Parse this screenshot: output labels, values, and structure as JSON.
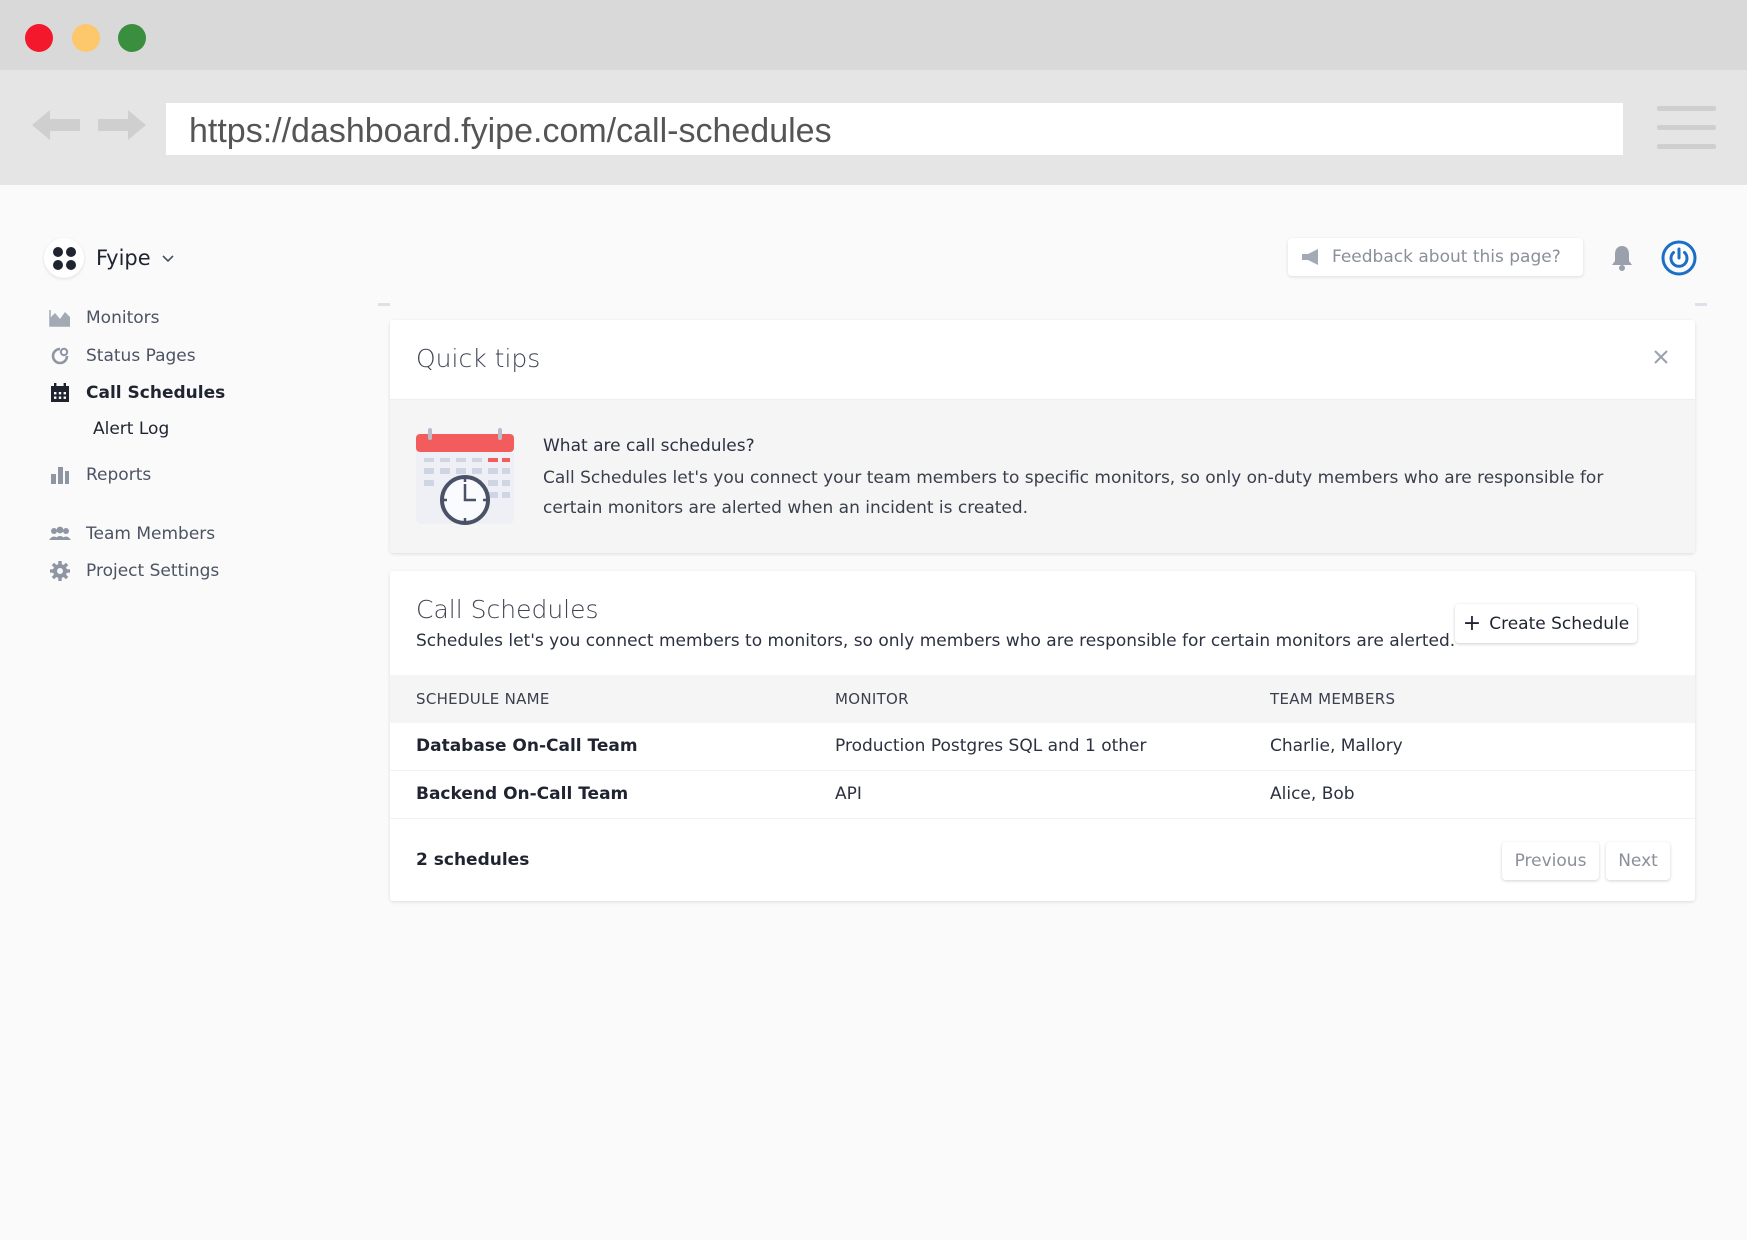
{
  "browser": {
    "url": "https://dashboard.fyipe.com/call-schedules"
  },
  "project": {
    "name": "Fyipe"
  },
  "header": {
    "feedback_placeholder": "Feedback about this page?"
  },
  "sidebar": {
    "items": [
      {
        "label": "Monitors",
        "icon": "area-chart-icon"
      },
      {
        "label": "Status Pages",
        "icon": "status-page-icon"
      },
      {
        "label": "Call Schedules",
        "icon": "calendar-icon",
        "active": true
      },
      {
        "label": "Alert Log"
      },
      {
        "label": "Reports",
        "icon": "bar-chart-icon"
      },
      {
        "label": "Team Members",
        "icon": "team-icon"
      },
      {
        "label": "Project Settings",
        "icon": "gear-icon"
      }
    ]
  },
  "quick_tips": {
    "title": "Quick tips",
    "question": "What are call schedules?",
    "text": "Call Schedules let's you connect your team members to specific monitors, so only on-duty members who are responsible for certain monitors are alerted when an incident is created."
  },
  "schedules": {
    "title": "Call Schedules",
    "description": "Schedules let's you connect members to monitors, so only members who are responsible for certain monitors are alerted.",
    "create_button": "Create Schedule",
    "columns": [
      "SCHEDULE NAME",
      "MONITOR",
      "TEAM MEMBERS"
    ],
    "rows": [
      {
        "name": "Database On-Call Team",
        "monitor": "Production Postgres SQL and 1 other",
        "members": "Charlie, Mallory"
      },
      {
        "name": "Backend On-Call Team",
        "monitor": "API",
        "members": "Alice, Bob"
      }
    ],
    "count": "2 schedules",
    "prev_label": "Previous",
    "next_label": "Next"
  },
  "colors": {
    "accent": "#1b6fc4",
    "close_red": "#f4182d",
    "minimize_yellow": "#fdc76b",
    "maximize_green": "#3a8f3f"
  }
}
